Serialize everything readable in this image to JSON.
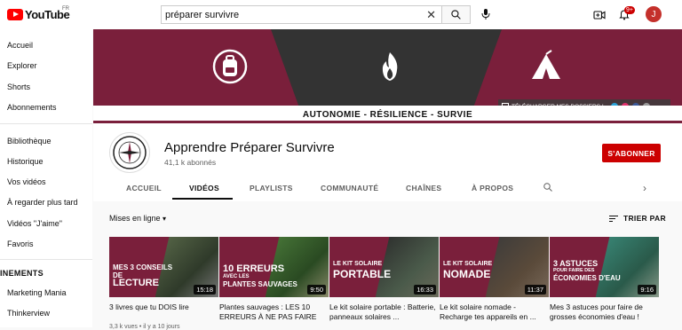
{
  "header": {
    "logo_text": "YouTube",
    "logo_country": "FR",
    "search_value": "préparer survivre",
    "notification_count": "9+",
    "avatar_letter": "J"
  },
  "sidebar": {
    "items": [
      "Accueil",
      "Explorer",
      "Shorts",
      "Abonnements",
      "Bibliothèque",
      "Historique",
      "Vos vidéos",
      "À regarder plus tard",
      "Vidéos \"J'aime\"",
      "Favoris"
    ],
    "section_title": "INEMENTS",
    "subscriptions": [
      "Marketing Mania",
      "Thinkerview"
    ]
  },
  "banner": {
    "motto": "AUTONOMIE - RÉSILIENCE - SURVIE",
    "download_text": "TÉLÉCHARGER MES DOSSIERS !",
    "colors": {
      "primary": "#7a1f3b",
      "dark": "#333333"
    }
  },
  "channel": {
    "name": "Apprendre Préparer Survivre",
    "subscribers": "41,1 k abonnés",
    "subscribe_label": "S'ABONNER",
    "tabs": [
      "ACCUEIL",
      "VIDÉOS",
      "PLAYLISTS",
      "COMMUNAUTÉ",
      "CHAÎNES",
      "À PROPOS"
    ]
  },
  "filter": {
    "left_label": "Mises en ligne",
    "sort_label": "TRIER PAR"
  },
  "videos": [
    {
      "thumb_lines": [
        "MES 3 CONSEILS",
        "DE",
        "LECTURE"
      ],
      "duration": "15:18",
      "title": "3 livres que tu DOIS lire",
      "meta": "3,3 k vues • il y a 10 jours"
    },
    {
      "thumb_lines": [
        "10 ERREURS",
        "AVEC LES",
        "PLANTES SAUVAGES"
      ],
      "duration": "9:50",
      "title": "Plantes sauvages : LES 10 ERREURS À NE PAS FAIRE",
      "meta": ""
    },
    {
      "thumb_lines": [
        "LE KIT SOLAIRE",
        "PORTABLE",
        ""
      ],
      "duration": "16:33",
      "title": "Le kit solaire portable : Batterie, panneaux solaires ...",
      "meta": ""
    },
    {
      "thumb_lines": [
        "LE KIT SOLAIRE",
        "NOMADE",
        ""
      ],
      "duration": "11:37",
      "title": "Le kit solaire nomade - Recharge tes appareils en ...",
      "meta": ""
    },
    {
      "thumb_lines": [
        "3 ASTUCES",
        "POUR FAIRE DES",
        "ÉCONOMIES D'EAU"
      ],
      "duration": "9:16",
      "title": "Mes 3 astuces pour faire de grosses économies d'eau !",
      "meta": ""
    }
  ]
}
